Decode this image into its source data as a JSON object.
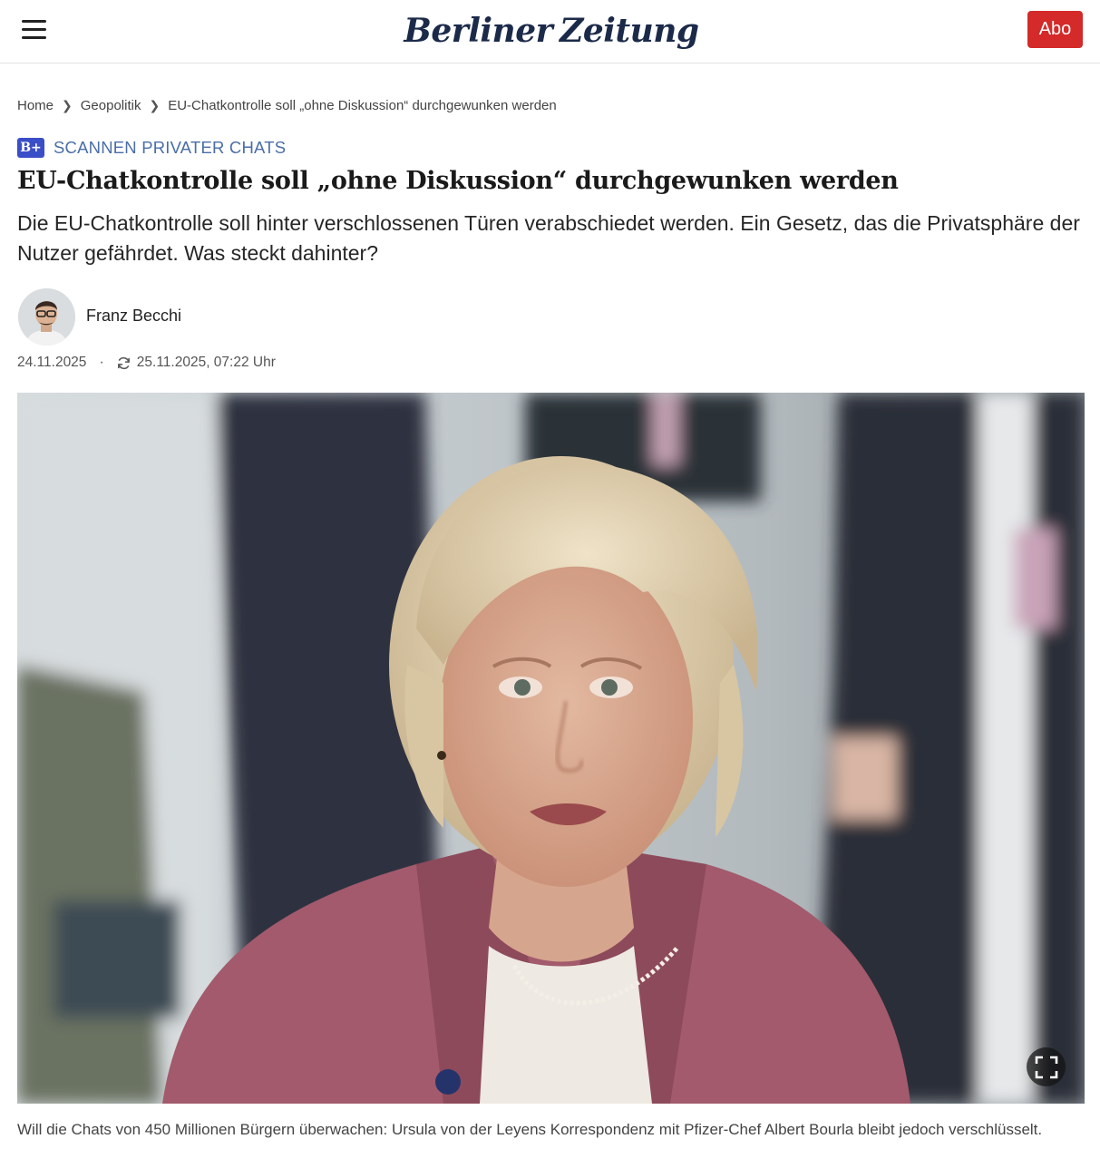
{
  "header": {
    "logo_text_left": "Berliner",
    "logo_text_right": "Zeitung",
    "abo_label": "Abo",
    "accent_color": "#d42a2a",
    "menu_icon": "hamburger-menu-icon"
  },
  "breadcrumb": {
    "items": [
      {
        "label": "Home"
      },
      {
        "label": "Geopolitik"
      },
      {
        "label": "EU-Chatkontrolle soll „ohne Diskussion“ durchgewunken werden"
      }
    ],
    "separator_icon": "chevron-right-icon"
  },
  "article": {
    "premium_badge": "B+",
    "kicker": "SCANNEN PRIVATER CHATS",
    "headline": "EU-Chatkontrolle soll „ohne Diskussion“ durchgewunken werden",
    "teaser": "Die EU-Chatkontrolle soll hinter verschlossenen Türen verabschiedet werden. Ein Gesetz, das die Privatsphäre der Nutzer gefährdet. Was steckt dahinter?",
    "author": "Franz Becchi",
    "published": "24.11.2025",
    "meta_separator": "·",
    "updated": "25.11.2025, 07:22 Uhr",
    "image_caption": "Will die Chats von 450 Millionen Bürgern überwachen: Ursula von der Leyens Korrespondenz mit Pfizer-Chef Albert Bourla bleibt jedoch verschlüsselt."
  }
}
